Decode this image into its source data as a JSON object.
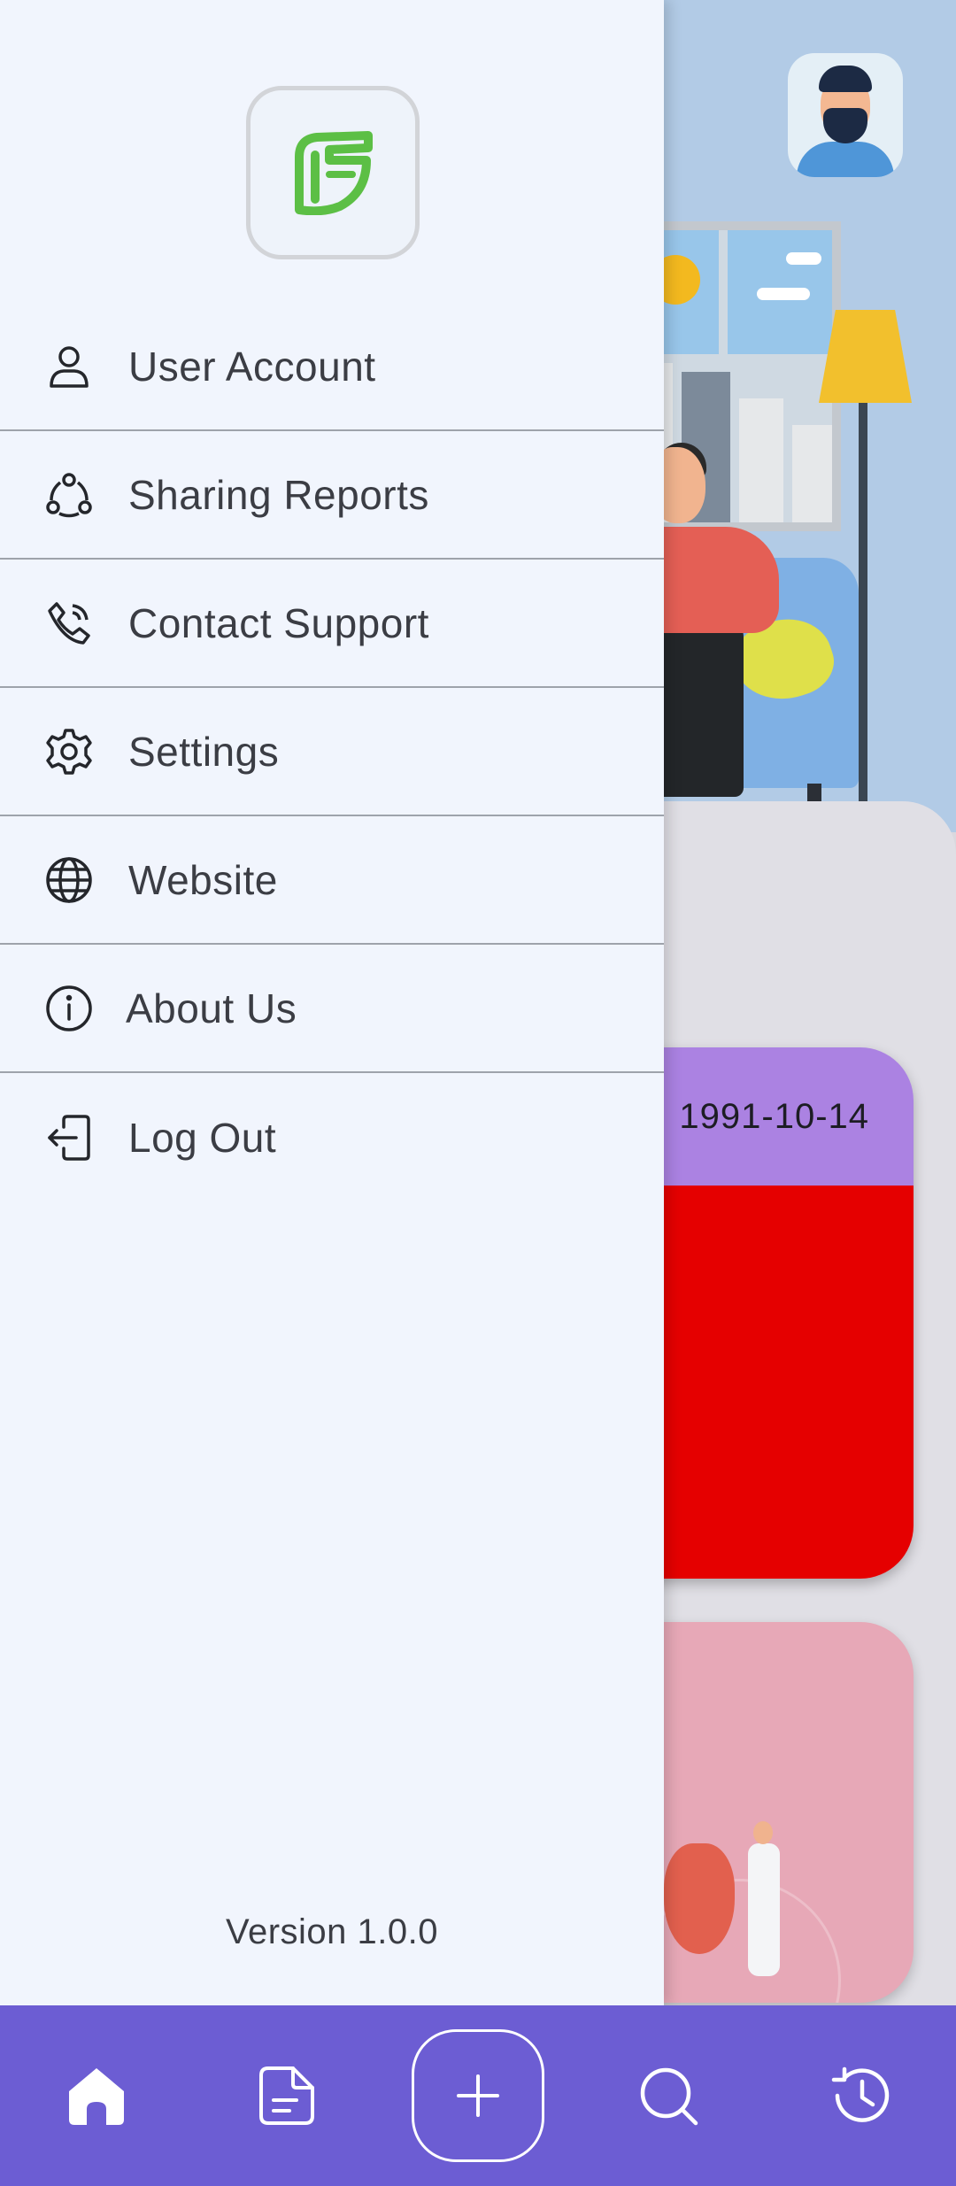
{
  "drawer": {
    "logo_icon": "leaf-logo-icon",
    "menu": [
      {
        "label": "User Account",
        "icon": "user-icon"
      },
      {
        "label": "Sharing Reports",
        "icon": "share-icon"
      },
      {
        "label": "Contact Support",
        "icon": "phone-icon"
      },
      {
        "label": "Settings",
        "icon": "gear-icon"
      },
      {
        "label": "Website",
        "icon": "globe-icon"
      },
      {
        "label": "About Us",
        "icon": "info-icon"
      },
      {
        "label": "Log Out",
        "icon": "logout-icon"
      }
    ],
    "version": "Version 1.0.0"
  },
  "background": {
    "record_card": {
      "date": "1991-10-14"
    }
  },
  "bottom_nav": {
    "items": [
      {
        "icon": "home-icon",
        "active": true
      },
      {
        "icon": "document-icon"
      },
      {
        "icon": "plus-icon"
      },
      {
        "icon": "search-icon"
      },
      {
        "icon": "history-icon"
      }
    ]
  },
  "colors": {
    "drawer_bg": "#f1f5fd",
    "accent": "#6c5dd3",
    "logo_green": "#5cbf45",
    "card_header": "#ab82e2",
    "card_body": "#e50000",
    "heart_card": "#e7a8b7"
  }
}
